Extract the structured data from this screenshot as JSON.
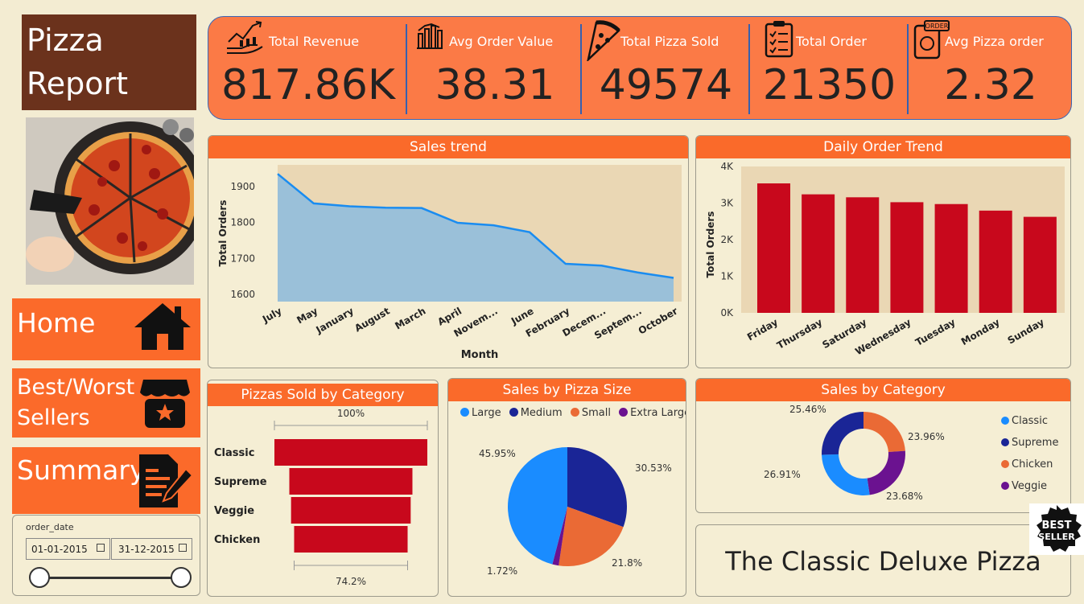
{
  "title": {
    "line1": "Pizza",
    "line2": "Report"
  },
  "nav": [
    {
      "label": "Home"
    },
    {
      "label1": "Best/Worst",
      "label2": "Sellers"
    },
    {
      "label": "Summary"
    }
  ],
  "filter": {
    "label": "order_date",
    "start": "01-01-2015",
    "end": "31-12-2015"
  },
  "kpis": [
    {
      "label": "Total Revenue",
      "value": "817.86K",
      "icon": "revenue-chart-icon"
    },
    {
      "label": "Avg Order Value",
      "value": "38.31",
      "icon": "bar-columns-icon"
    },
    {
      "label": "Total Pizza Sold",
      "value": "49574",
      "icon": "pizza-slice-icon"
    },
    {
      "label": "Total Order",
      "value": "21350",
      "icon": "clipboard-list-icon"
    },
    {
      "label": "Avg Pizza order",
      "value": "2.32",
      "icon": "order-phone-icon"
    }
  ],
  "badge": {
    "line1": "BEST",
    "line2": "SELLER"
  },
  "best_pizza": "The Classic Deluxe Pizza",
  "colors": {
    "orange": "#fb6a2a",
    "brown": "#6b321c",
    "red_bar": "#c8081c",
    "line": "#1a8cf0",
    "blue": "#1a8cff",
    "navy": "#1a2596",
    "veg_purple": "#6b1290"
  },
  "chart_data": [
    {
      "type": "area",
      "title": "Sales trend",
      "xlabel": "Month",
      "ylabel": "Total Orders",
      "categories": [
        "July",
        "May",
        "January",
        "August",
        "March",
        "April",
        "Novem...",
        "June",
        "February",
        "Decem...",
        "Septem...",
        "October"
      ],
      "values": [
        1935,
        1853,
        1845,
        1841,
        1840,
        1799,
        1792,
        1773,
        1685,
        1680,
        1661,
        1646
      ],
      "yticks": [
        "1600",
        "1700",
        "1800",
        "1900"
      ],
      "ylim": [
        1580,
        1960
      ]
    },
    {
      "type": "bar",
      "title": "Daily Order Trend",
      "ylabel": "Total Orders",
      "categories": [
        "Friday",
        "Thursday",
        "Saturday",
        "Wednesday",
        "Tuesday",
        "Monday",
        "Sunday"
      ],
      "values": [
        3538,
        3239,
        3158,
        3024,
        2973,
        2794,
        2624
      ],
      "yticks": [
        "0K",
        "1K",
        "2K",
        "3K",
        "4K"
      ],
      "ylim": [
        0,
        4000
      ]
    },
    {
      "type": "bar",
      "title": "Pizzas Sold by Category",
      "categories": [
        "Classic",
        "Supreme",
        "Veggie",
        "Chicken"
      ],
      "values": [
        14888,
        11987,
        11649,
        11050
      ],
      "top_label": "100%",
      "bottom_label": "74.2%"
    },
    {
      "type": "pie",
      "title": "Sales by Pizza Size",
      "legend": [
        "Large",
        "Medium",
        "Small",
        "Extra Large"
      ],
      "values": [
        45.95,
        30.53,
        21.8,
        1.72
      ],
      "labels": [
        "45.95%",
        "30.53%",
        "21.8%",
        "1.72%"
      ],
      "colors": [
        "#1a8cff",
        "#1a2596",
        "#ea6a35",
        "#6b1290"
      ]
    },
    {
      "type": "pie",
      "title": "Sales by Category",
      "legend": [
        "Classic",
        "Supreme",
        "Chicken",
        "Veggie"
      ],
      "values": [
        26.91,
        25.46,
        23.96,
        23.68
      ],
      "labels": [
        "26.91%",
        "25.46%",
        "23.96%",
        "23.68%"
      ],
      "colors": [
        "#1a8cff",
        "#1a2596",
        "#ea6a35",
        "#6b1290"
      ]
    }
  ]
}
